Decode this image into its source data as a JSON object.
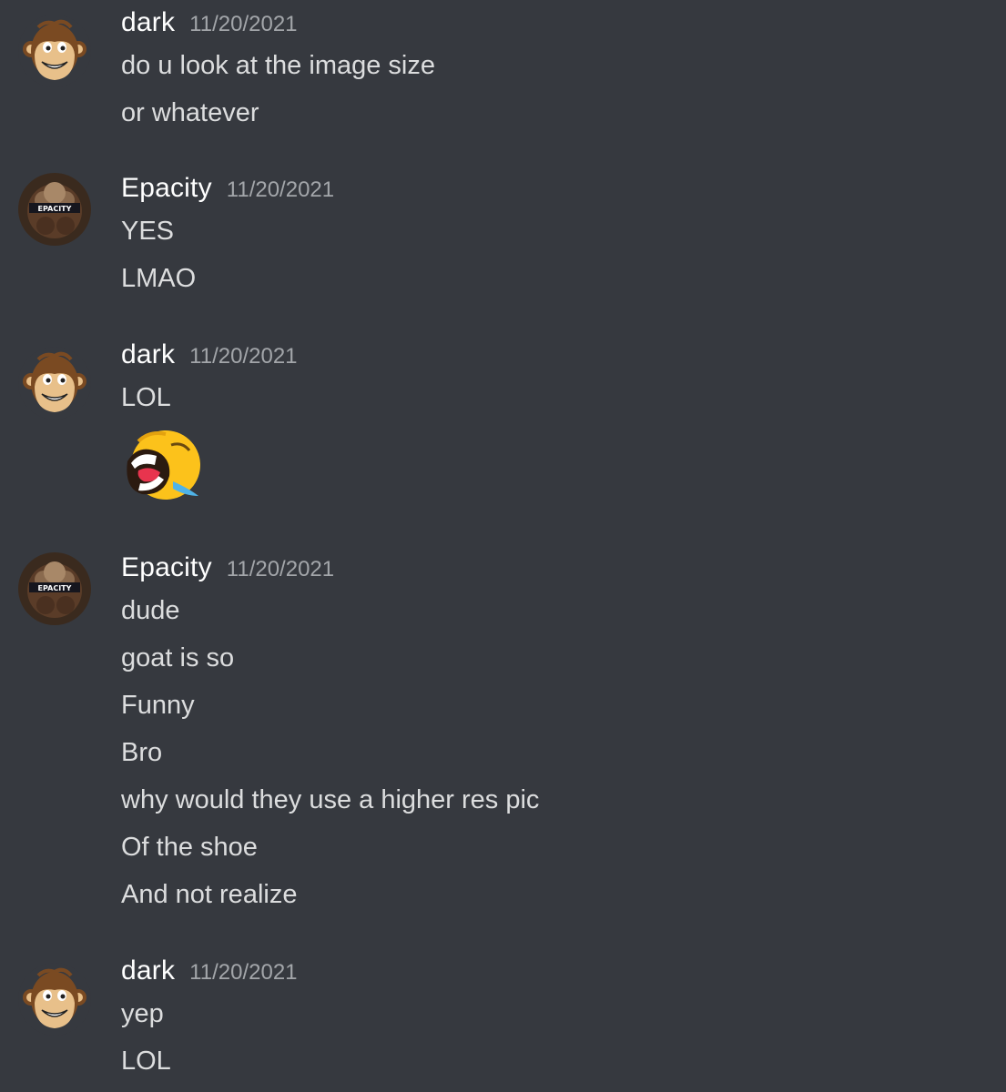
{
  "colors": {
    "background": "#36393f",
    "username": "#ffffff",
    "timestamp": "#a3a6aa",
    "message_text": "#dcddde"
  },
  "groups": [
    {
      "author": "dark",
      "avatar_icon": "curious-george-avatar-icon",
      "timestamp": "11/20/2021",
      "lines": [
        "do u look at the image size",
        "or whatever"
      ]
    },
    {
      "author": "Epacity",
      "avatar_icon": "epacity-avatar-icon",
      "avatar_label": "EPACITY",
      "timestamp": "11/20/2021",
      "lines": [
        "YES",
        "LMAO"
      ]
    },
    {
      "author": "dark",
      "avatar_icon": "curious-george-avatar-icon",
      "timestamp": "11/20/2021",
      "lines": [
        "LOL"
      ],
      "emoji": "laughing-emoji-icon"
    },
    {
      "author": "Epacity",
      "avatar_icon": "epacity-avatar-icon",
      "avatar_label": "EPACITY",
      "timestamp": "11/20/2021",
      "lines": [
        "dude",
        "goat is so",
        "Funny",
        "Bro",
        "why would they use a higher res pic",
        "Of the shoe",
        "And not realize"
      ]
    },
    {
      "author": "dark",
      "avatar_icon": "curious-george-avatar-icon",
      "timestamp": "11/20/2021",
      "lines": [
        "yep",
        "LOL"
      ]
    }
  ]
}
